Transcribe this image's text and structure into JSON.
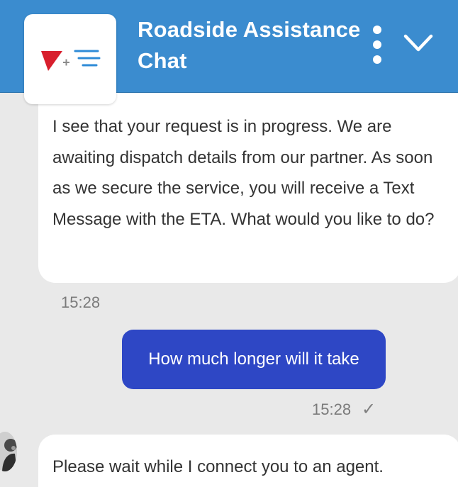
{
  "header": {
    "title": "Roadside Assistance Chat",
    "menu_icon": "more-vertical-icon",
    "collapse_icon": "chevron-down-icon",
    "logo_icon": "brand-logo"
  },
  "messages": [
    {
      "sender": "bot",
      "text": "I see that your request is in progress. We are awaiting dispatch details from our partner. As soon as we secure the service, you will receive a Text Message with the ETA. What would you like to do?",
      "time": "15:28"
    },
    {
      "sender": "user",
      "text": "How much longer will it take",
      "time": "15:28",
      "status_icon": "checkmark-icon",
      "status": "✓"
    },
    {
      "sender": "bot",
      "text": "Please wait while I connect you to an agent."
    }
  ],
  "colors": {
    "header": "#3b8ccf",
    "user_bubble": "#2e47c5",
    "background": "#e9e9e9",
    "bot_bubble": "#ffffff"
  }
}
